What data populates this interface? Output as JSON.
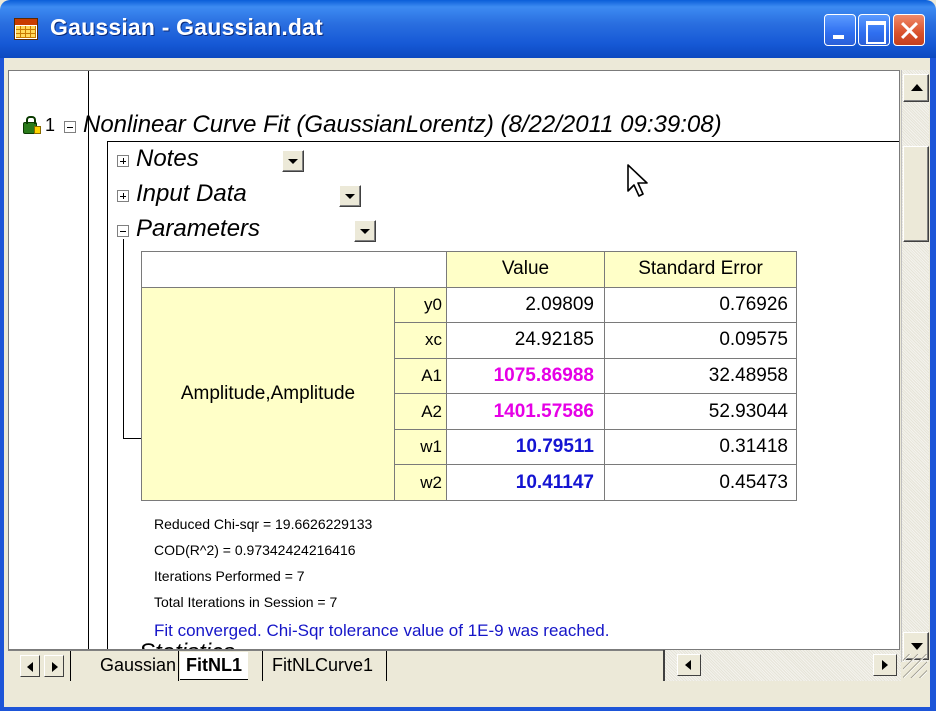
{
  "window": {
    "title": "Gaussian - Gaussian.dat"
  },
  "report": {
    "row_number": "1",
    "root_label": "Nonlinear Curve Fit (GaussianLorentz) (8/22/2011 09:39:08)",
    "nodes": {
      "notes": "Notes",
      "input_data": "Input Data",
      "parameters": "Parameters",
      "statistics_truncated": "Statistics"
    },
    "table": {
      "headers": {
        "value": "Value",
        "std_error": "Standard Error"
      },
      "group_label": "Amplitude,Amplitude",
      "rows": [
        {
          "name": "y0",
          "value": "2.09809",
          "std_error": "0.76926",
          "value_color": "#000000"
        },
        {
          "name": "xc",
          "value": "24.92185",
          "std_error": "0.09575",
          "value_color": "#000000"
        },
        {
          "name": "A1",
          "value": "1075.86988",
          "std_error": "32.48958",
          "value_color": "#e600e6"
        },
        {
          "name": "A2",
          "value": "1401.57586",
          "std_error": "52.93044",
          "value_color": "#e600e6"
        },
        {
          "name": "w1",
          "value": "10.79511",
          "std_error": "0.31418",
          "value_color": "#1414d2"
        },
        {
          "name": "w2",
          "value": "10.41147",
          "std_error": "0.45473",
          "value_color": "#1414d2"
        }
      ]
    },
    "stats": {
      "reduced_chi_sqr": "Reduced Chi-sqr = 19.6626229133",
      "cod": "COD(R^2) = 0.97342424216416",
      "iterations": "Iterations Performed = 7",
      "total_iterations": "Total Iterations in Session = 7",
      "converged": "Fit converged. Chi-Sqr tolerance value of 1E-9 was reached."
    }
  },
  "sheet_tabs": [
    {
      "label": "Gaussian",
      "active": false
    },
    {
      "label": "FitNL1",
      "active": true
    },
    {
      "label": "FitNLCurve1",
      "active": false
    }
  ]
}
